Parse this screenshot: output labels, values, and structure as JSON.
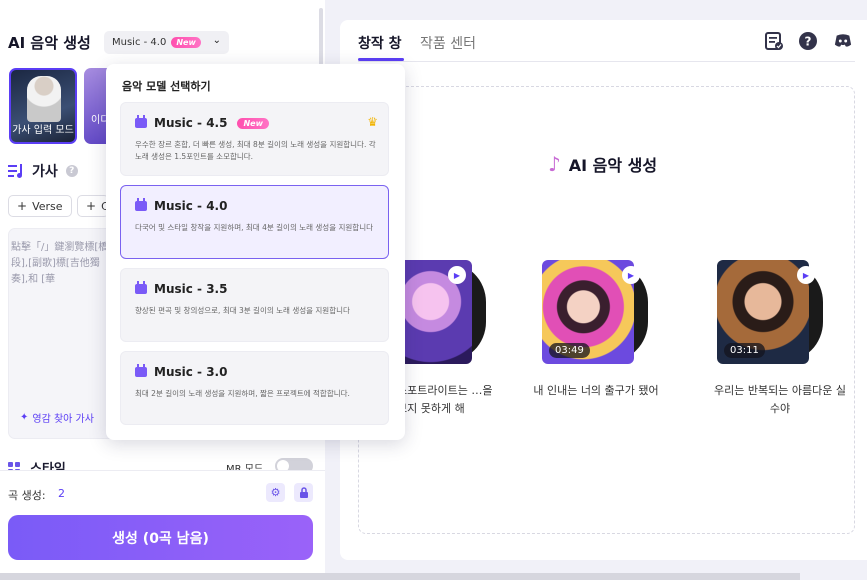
{
  "app": {
    "title": "AI 음악 생성",
    "model_label": "Music - 4.0",
    "new_badge": "New"
  },
  "modes": [
    {
      "label": "가사 입력 모드"
    },
    {
      "label": "이디"
    }
  ],
  "lyrics": {
    "heading": "가사",
    "chips": [
      {
        "label": "Verse"
      },
      {
        "label": "C"
      }
    ],
    "placeholder": "點擊「/」鍵瀏覽標[橋段],[副歌]標[吉他獨奏],和 [華",
    "inspire_label": "영감 찾아 가사"
  },
  "style": {
    "heading": "스타일",
    "mr_mode_label": "MR 모드",
    "mr_mode_on": false
  },
  "generation": {
    "count_label": "곡 생성:",
    "count_value": "2",
    "button_label": "생성 (0곡 남음)"
  },
  "right": {
    "tabs": [
      {
        "label": "창작 창",
        "active": true
      },
      {
        "label": "작품 센터",
        "active": false
      }
    ],
    "canvas_title": "AI 음악 생성",
    "cards": [
      {
        "title": "스포트라이트는 …을 보지 못하게 해",
        "duration": ""
      },
      {
        "title": "내 인내는 너의 출구가 됐어",
        "duration": "03:49"
      },
      {
        "title": "우리는 반복되는 아름다운 실수야",
        "duration": "03:11"
      }
    ]
  },
  "dropdown": {
    "title": "음악 모델 선택하기",
    "options": [
      {
        "name": "Music - 4.5",
        "badge": "New",
        "premium": true,
        "selected": false,
        "desc": "우수한 장르 혼합, 더 빠른 생성, 최대 8분 길이의 노래 생성을 지원합니다. 각 노래 생성은 1.5포인트를 소모합니다."
      },
      {
        "name": "Music - 4.0",
        "badge": "",
        "premium": false,
        "selected": true,
        "desc": "다국어 및 스타일 창작을 지원하며, 최대 4분 길이의 노래 생성을 지원합니다"
      },
      {
        "name": "Music - 3.5",
        "badge": "",
        "premium": false,
        "selected": false,
        "desc": "향상된 편곡 및 창의성으로, 최대 3분 길이의 노래 생성을 지원합니다"
      },
      {
        "name": "Music - 3.0",
        "badge": "",
        "premium": false,
        "selected": false,
        "desc": "최대 2분 길이의 노래 생성을 지원하며, 짧은 프로젝트에 적합합니다."
      }
    ]
  },
  "colors": {
    "accent": "#5b3ef5",
    "button_gradient_start": "#7a5bf7",
    "button_gradient_end": "#9a62f9",
    "new_badge": "#ff4fae"
  }
}
